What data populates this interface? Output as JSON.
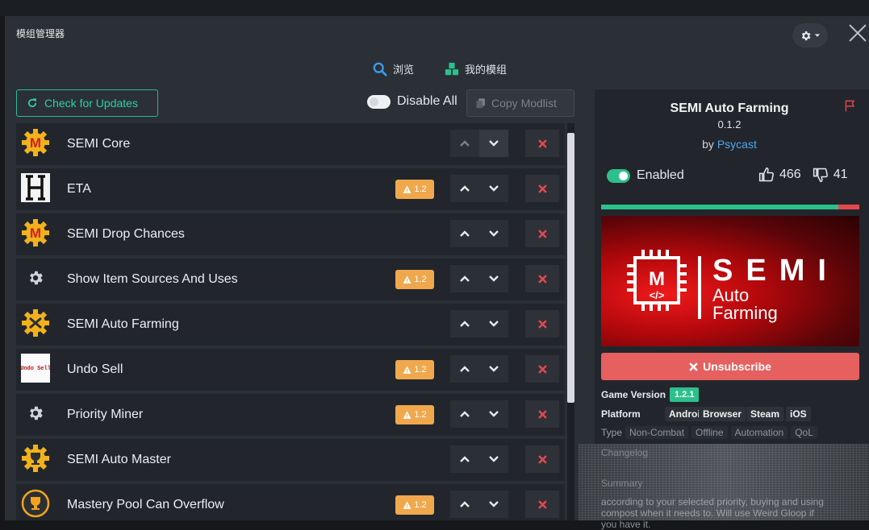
{
  "window": {
    "title": "模组管理器"
  },
  "tabs": [
    {
      "label": "浏览"
    },
    {
      "label": "我的模组"
    }
  ],
  "toolbar": {
    "check_updates": "Check for Updates",
    "disable_all": "Disable All",
    "copy_modlist": "Copy Modlist"
  },
  "mods": [
    {
      "name": "SEMI Core",
      "icon": "semi-m-icon",
      "warning": ""
    },
    {
      "name": "ETA",
      "icon": "eta-h-icon",
      "warning": "1.2"
    },
    {
      "name": "SEMI Drop Chances",
      "icon": "semi-m-icon",
      "warning": ""
    },
    {
      "name": "Show Item Sources And Uses",
      "icon": "gear-icon",
      "warning": "1.2"
    },
    {
      "name": "SEMI Auto Farming",
      "icon": "semi-farming-icon",
      "warning": ""
    },
    {
      "name": "Undo Sell",
      "icon": "undo-sell-icon",
      "icon_text": "Undo Sell",
      "warning": "1.2"
    },
    {
      "name": "Priority Miner",
      "icon": "gear-icon",
      "warning": "1.2"
    },
    {
      "name": "SEMI Auto Master",
      "icon": "semi-master-icon",
      "warning": ""
    },
    {
      "name": "Mastery Pool Can Overflow",
      "icon": "trophy-icon",
      "warning": "1.2"
    }
  ],
  "detail": {
    "title": "SEMI Auto Farming",
    "version": "0.1.2",
    "by_prefix": "by",
    "author": "Psycast",
    "status": "Enabled",
    "likes": "466",
    "dislikes": "41",
    "like_ratio": 0.919,
    "banner": {
      "big": "SEMI",
      "line1": "Auto",
      "line2": "Farming",
      "chip_letter": "M",
      "chip_code": "</>"
    },
    "unsubscribe": "Unsubscribe",
    "game_version_label": "Game Version",
    "game_version": "1.2.1",
    "platform_label": "Platform",
    "platforms": [
      "Android",
      "Browser",
      "Steam",
      "iOS"
    ],
    "type_label": "Type",
    "types": [
      "Non-Combat",
      "Offline",
      "Automation",
      "QoL"
    ],
    "changelog_label": "Changelog",
    "summary_label": "Summary",
    "summary_lines": [
      "according to your selected priority, buying and using",
      "compost when it needs to. Will use Weird Gloop if",
      "you have it."
    ]
  },
  "colors": {
    "accent_green": "#2cc08c",
    "danger_red": "#e5484d",
    "warning_orange": "#f0a84d",
    "link_blue": "#4fa6ee"
  }
}
